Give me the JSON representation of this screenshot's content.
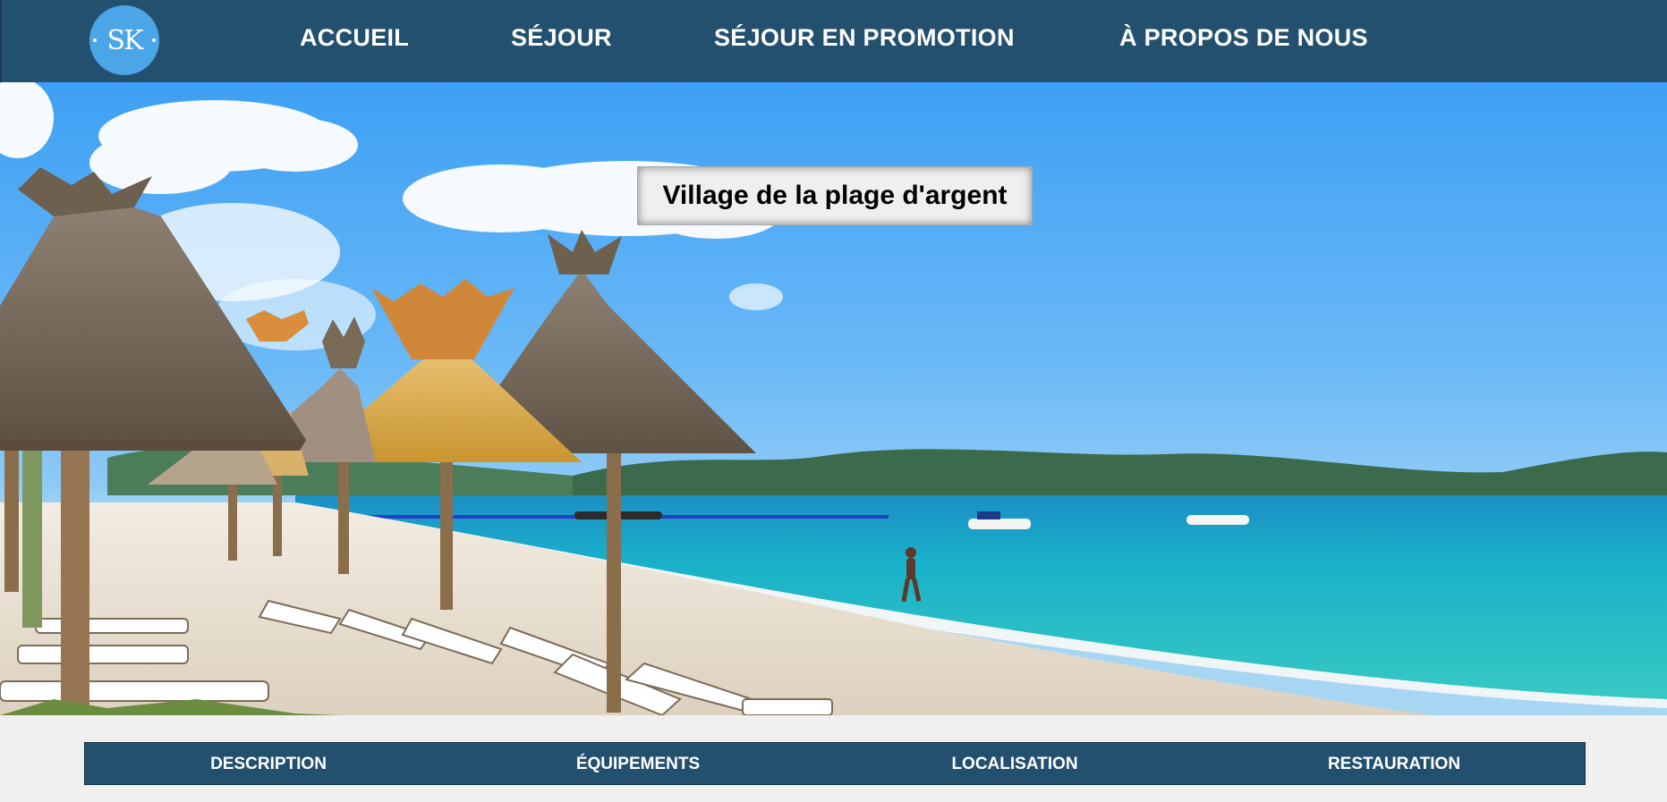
{
  "header": {
    "logo_text": "SK",
    "nav": [
      {
        "label": "ACCUEIL"
      },
      {
        "label": "SÉJOUR"
      },
      {
        "label": "SÉJOUR EN PROMOTION"
      },
      {
        "label": "À PROPOS DE NOUS"
      }
    ]
  },
  "hero": {
    "title": "Village de la plage d'argent",
    "image": "beach-with-straw-umbrellas-and-sea"
  },
  "tabs": [
    {
      "label": "DESCRIPTION"
    },
    {
      "label": "ÉQUIPEMENTS"
    },
    {
      "label": "LOCALISATION"
    },
    {
      "label": "RESTAURATION"
    }
  ],
  "colors": {
    "nav_background": "#23506f",
    "logo_background": "#4aa6e6",
    "page_background": "#f0f0f0"
  }
}
